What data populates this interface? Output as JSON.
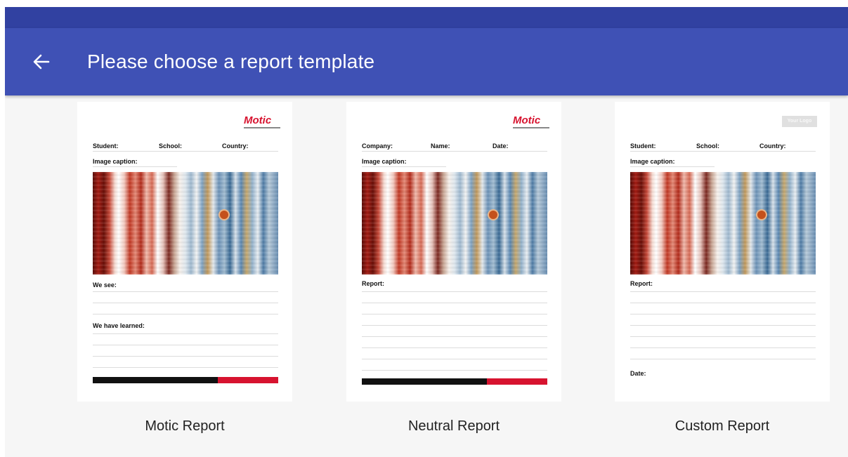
{
  "appbar": {
    "title": "Please choose a report template",
    "back_icon": "arrow-left-icon"
  },
  "colors": {
    "statusbar": "#3141a1",
    "appbar": "#3f51b5",
    "brand_red": "#d7132f",
    "background": "#f6f6f6"
  },
  "templates": [
    {
      "caption": "Motic Report",
      "logo": "Motic",
      "fields": [
        "Student:",
        "School:",
        "Country:"
      ],
      "image_caption": "Image caption:",
      "section1": "We see:",
      "section2": "We have learned:"
    },
    {
      "caption": "Neutral Report",
      "logo": "Motic",
      "fields": [
        "Company:",
        "Name:",
        "Date:"
      ],
      "image_caption": "Image caption:",
      "section1": "Report:"
    },
    {
      "caption": "Custom Report",
      "logo": "Your Logo",
      "fields": [
        "Student:",
        "School:",
        "Country:"
      ],
      "image_caption": "Image caption:",
      "section1": "Report:",
      "date_label": "Date:"
    }
  ]
}
